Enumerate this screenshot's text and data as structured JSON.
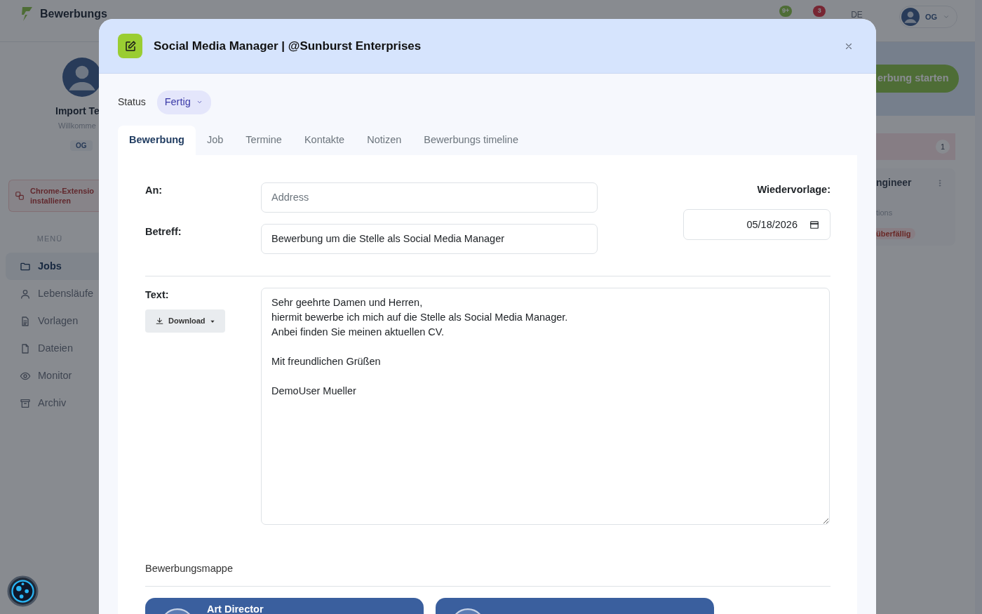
{
  "header": {
    "brand": "Bewerbungs",
    "badges": [
      "9+",
      "3"
    ],
    "language": "DE",
    "user_initials": "OG"
  },
  "sidebar": {
    "profile_name": "Import Te",
    "greeting": "Willkomme",
    "initials_tag": "OG",
    "extension_button": [
      "Chrome-Extensio",
      "installieren"
    ],
    "menu_heading": "MENÜ",
    "items": [
      {
        "label": "Jobs",
        "kind": "folder",
        "selected": true
      },
      {
        "label": "Lebensläufe",
        "kind": "person",
        "selected": false
      },
      {
        "label": "Vorlagen",
        "kind": "document",
        "selected": false
      },
      {
        "label": "Dateien",
        "kind": "file",
        "selected": false
      },
      {
        "label": "Monitor",
        "kind": "eye",
        "selected": false
      },
      {
        "label": "Archiv",
        "kind": "archive",
        "selected": false
      }
    ]
  },
  "board": {
    "start_button": "erbung starten",
    "column_count": "1",
    "job_card": {
      "title": "ngineer",
      "subtitle": "tions",
      "tag": "überfällig"
    }
  },
  "modal": {
    "title": "Social Media Manager | @Sunburst Enterprises",
    "status_label": "Status",
    "status": "Fertig",
    "tabs": [
      {
        "label": "Bewerbung",
        "selected": true
      },
      {
        "label": "Job",
        "selected": false
      },
      {
        "label": "Termine",
        "selected": false
      },
      {
        "label": "Kontakte",
        "selected": false
      },
      {
        "label": "Notizen",
        "selected": false
      },
      {
        "label": "Bewerbungs timeline",
        "selected": false
      }
    ],
    "to_label": "An:",
    "to_placeholder": "Address",
    "subject_label": "Betreff:",
    "subject_value": "Bewerbung um die Stelle als Social Media Manager",
    "followup_label": "Wiedervorlage:",
    "followup_date": "05/18/2026",
    "text_label": "Text:",
    "download_button": "Download",
    "text_value": "Sehr geehrte Damen und Herren,\nhiermit bewerbe ich mich auf die Stelle als Social Media Manager.\nAnbei finden Sie meinen aktuellen CV.\n\nMit freundlichen Grüßen\n\nDemoUser Mueller",
    "folder_heading": "Bewerbungsmappe",
    "documents": [
      {
        "kind": "titled",
        "title": "Art Director"
      },
      {
        "kind": "cut"
      }
    ]
  }
}
